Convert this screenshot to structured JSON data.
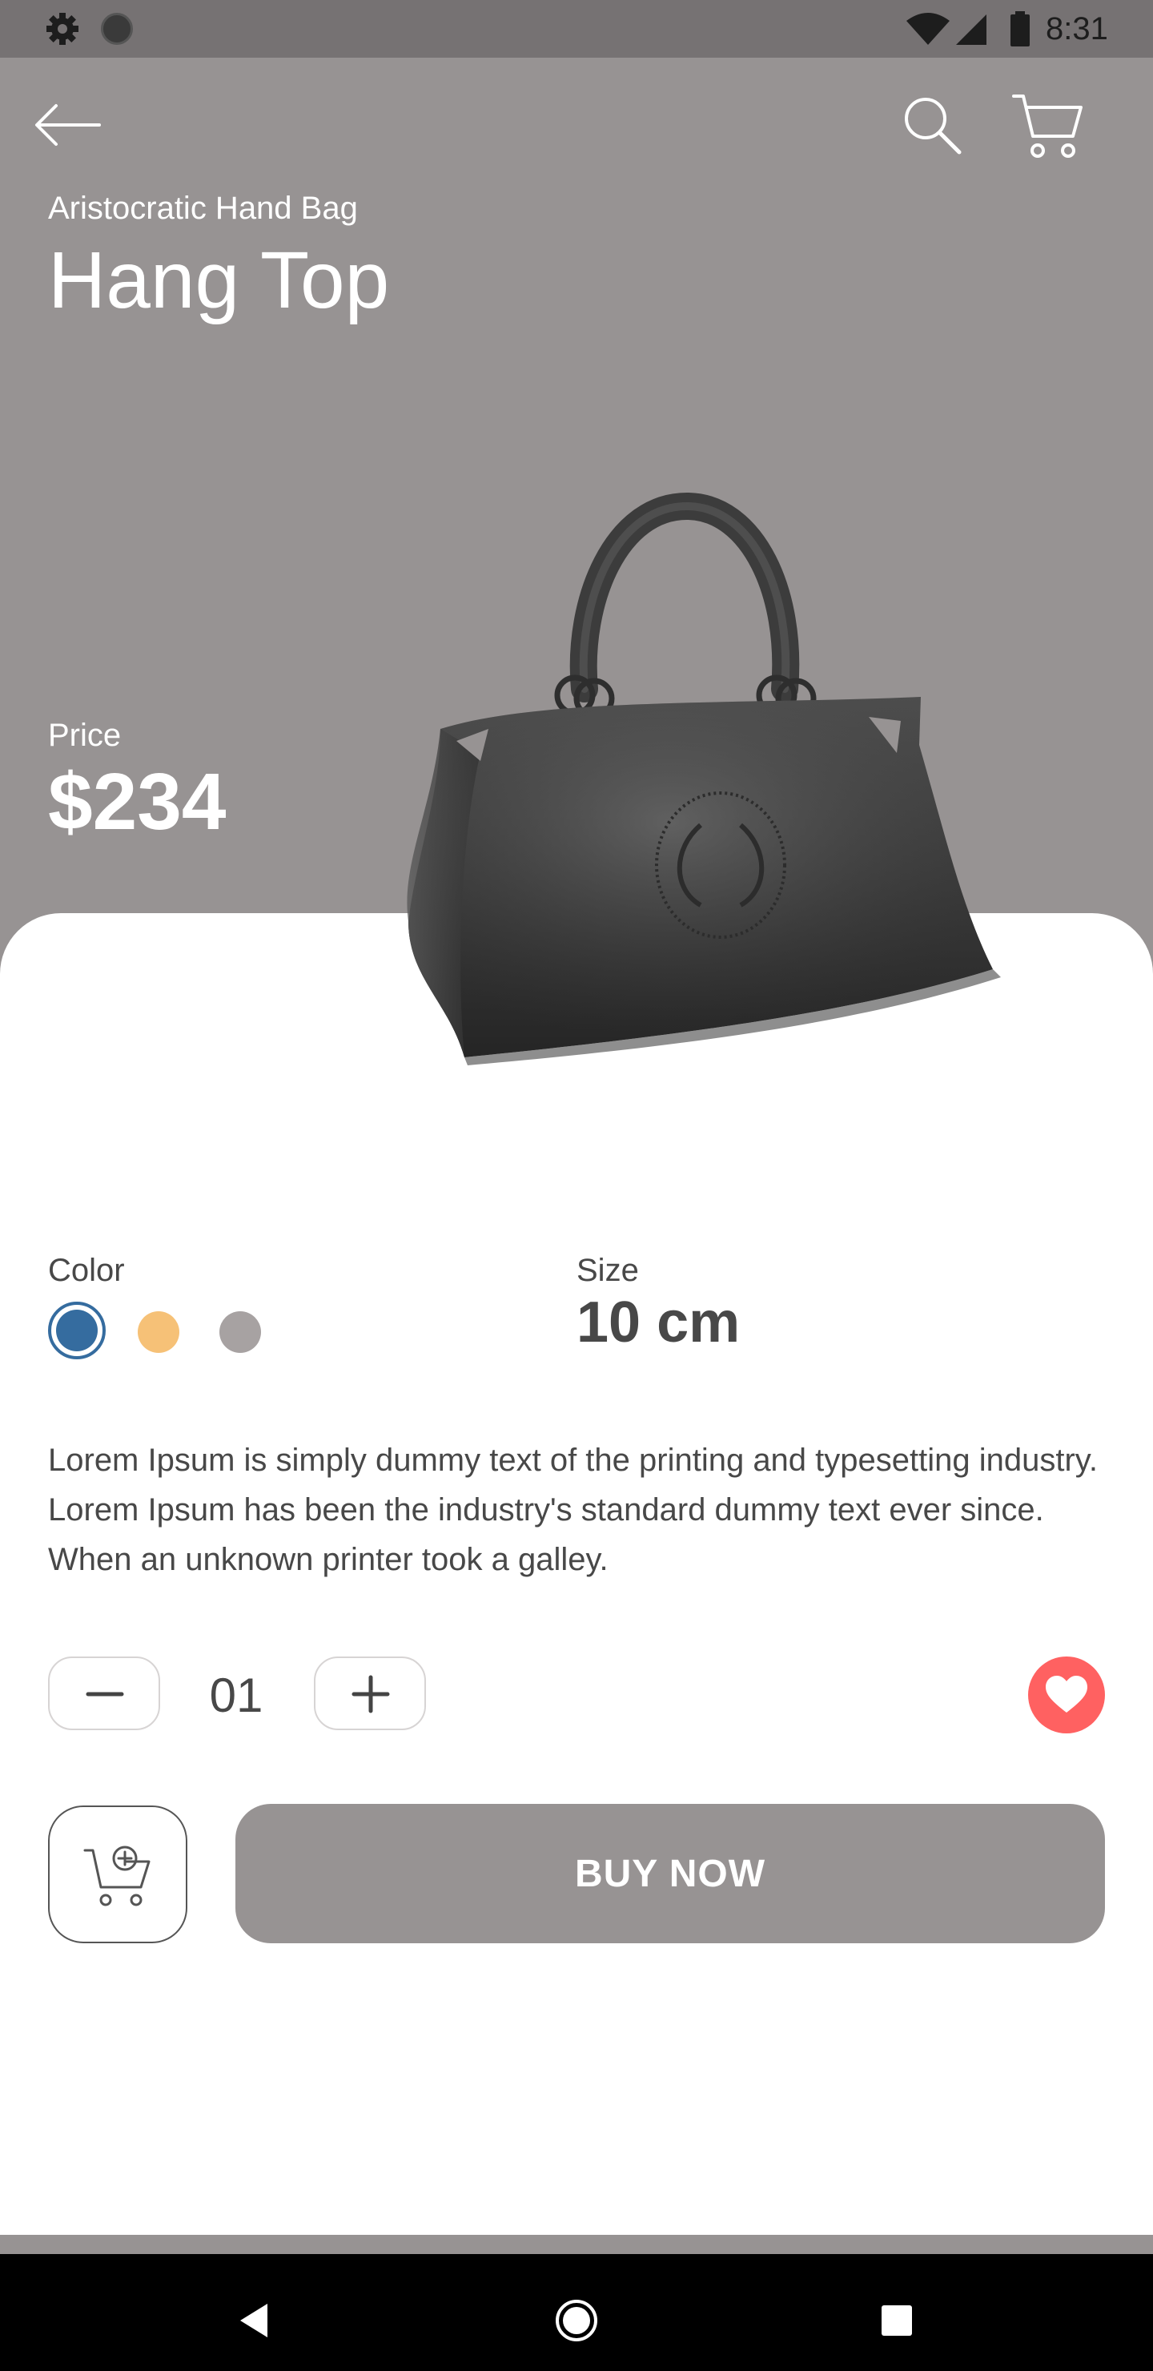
{
  "status_bar": {
    "time": "8:31",
    "icons": [
      "gear-icon",
      "circle-icon",
      "wifi-icon",
      "signal-icon",
      "battery-icon"
    ]
  },
  "app_bar": {
    "icons": [
      "back-arrow-icon",
      "search-icon",
      "cart-icon"
    ]
  },
  "product": {
    "category": "Aristocratic Hand Bag",
    "name": "Hang Top",
    "price_label": "Price",
    "price": "$234",
    "image": "handbag-image"
  },
  "options": {
    "color_label": "Color",
    "colors": [
      "#356c9f",
      "#f6c177",
      "#a7a2a2"
    ],
    "selected_color": "#356c9f",
    "size_label": "Size",
    "size_value": "10 cm"
  },
  "description": "Lorem Ipsum is simply dummy text of the printing and typesetting industry. Lorem Ipsum has been the industry's standard dummy text ever since. When an unknown printer took a galley.",
  "quantity": {
    "value": "01",
    "decrement_icon": "minus-icon",
    "increment_icon": "plus-icon"
  },
  "favorite": {
    "icon": "heart-icon",
    "color": "#ff6161"
  },
  "actions": {
    "add_to_cart_icon": "add-to-cart-icon",
    "buy_now_label": "BUY NOW"
  },
  "theme": {
    "primary": "#979393",
    "text": "#484848",
    "accent": "#ff6161"
  },
  "nav_bar": {
    "icons": [
      "nav-back-icon",
      "nav-home-icon",
      "nav-recents-icon"
    ]
  }
}
